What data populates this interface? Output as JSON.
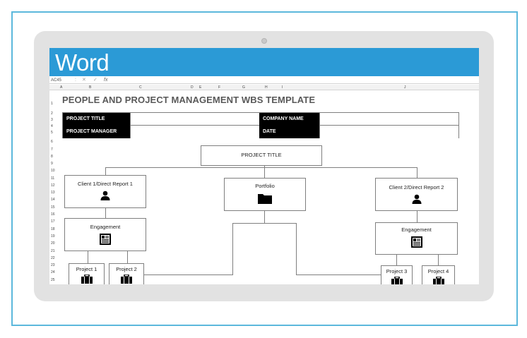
{
  "app": {
    "name": "Word"
  },
  "formula_bar": {
    "cell_ref": "AC45",
    "cancel": "✕",
    "enter": "✓",
    "fx": "fx"
  },
  "columns": [
    "A",
    "B",
    "C",
    "D",
    "E",
    "F",
    "G",
    "H",
    "I",
    "J"
  ],
  "rows": [
    "1",
    "2",
    "3",
    "4",
    "5",
    "6",
    "7",
    "8",
    "9",
    "10",
    "11",
    "12",
    "13",
    "14",
    "15",
    "16",
    "17",
    "18",
    "19",
    "20",
    "21",
    "22",
    "23",
    "24",
    "25"
  ],
  "sheet": {
    "title": "PEOPLE AND PROJECT MANAGEMENT WBS TEMPLATE",
    "info": {
      "project_title_label": "PROJECT TITLE",
      "project_manager_label": "PROJECT MANAGER",
      "company_name_label": "COMPANY NAME",
      "date_label": "DATE"
    }
  },
  "wbs": {
    "root": "PROJECT TITLE",
    "client1": "Client 1/Direct Report 1",
    "portfolio": "Portfolio",
    "client2": "Client 2/Direct Report 2",
    "engagement_left": "Engagement",
    "engagement_right": "Engagement",
    "project1": "Project 1",
    "project2": "Project 2",
    "project3": "Project 3",
    "project4": "Project 4"
  },
  "colors": {
    "frame_border": "#5cb8dc",
    "titlebar": "#2b9ad6",
    "header_fill": "#000000"
  },
  "icons": {
    "person": "person-icon",
    "folder": "folder-icon",
    "document": "document-icon",
    "briefcase": "briefcase-icon"
  }
}
